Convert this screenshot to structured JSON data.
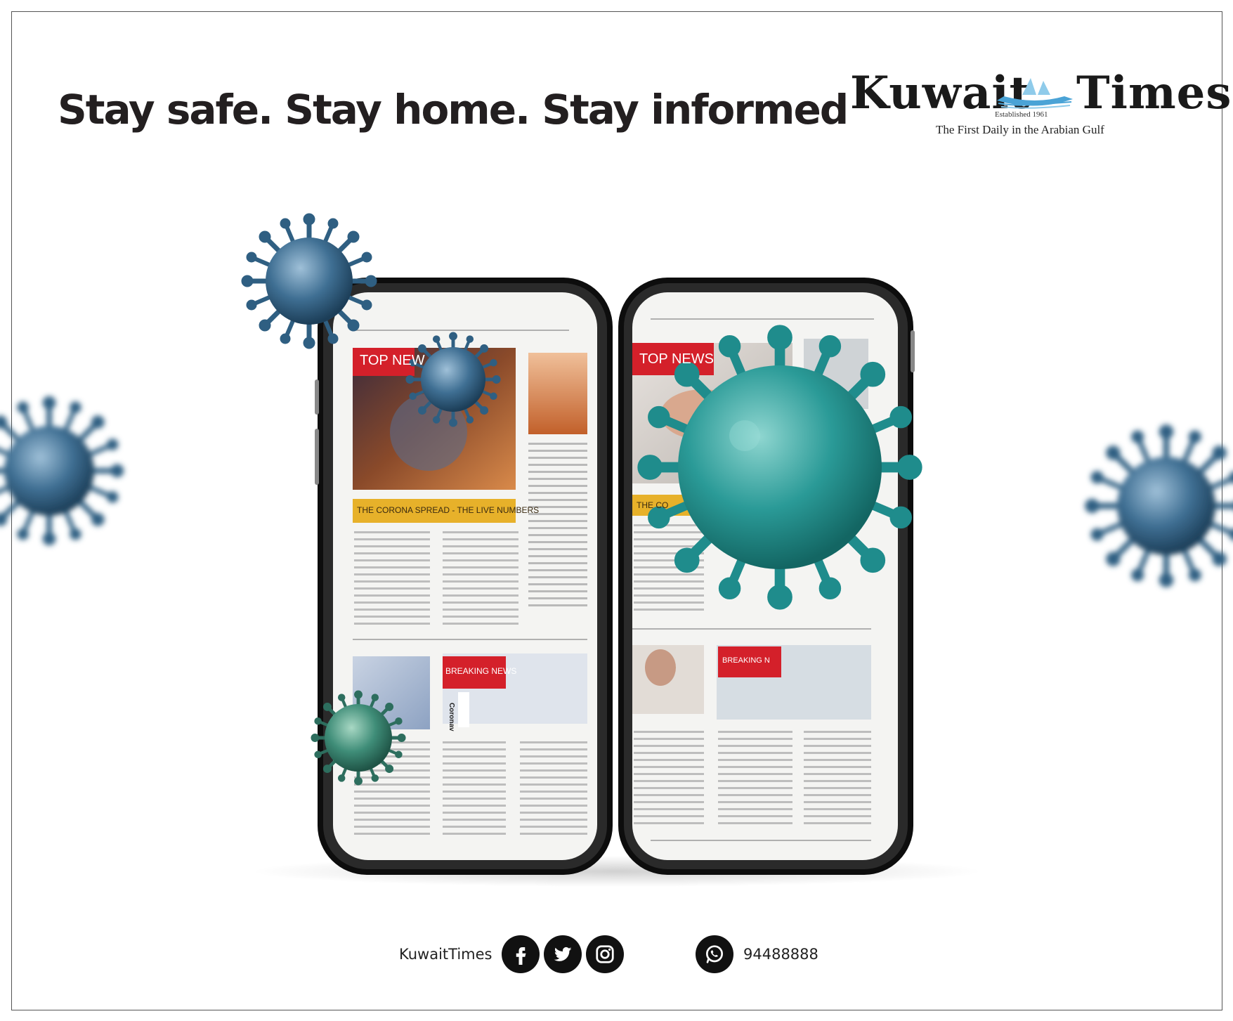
{
  "headline": "Stay safe. Stay home. Stay informed",
  "logo": {
    "word_left": "Kuwait",
    "word_right": "Times",
    "established": "Established 1961",
    "tagline": "The First Daily in the Arabian Gulf"
  },
  "left_phone": {
    "top_news_label": "TOP NEW",
    "banner": "THE CORONA SPREAD - THE LIVE NUMBERS",
    "breaking_label": "BREAKING NEWS",
    "side_caption": "Coronav"
  },
  "right_phone": {
    "top_news_label": "TOP NEWS",
    "banner": "THE CO",
    "breaking_label": "BREAKING N"
  },
  "footer": {
    "handle": "KuwaitTimes",
    "phone": "94488888"
  },
  "icons": [
    "facebook-icon",
    "twitter-icon",
    "instagram-icon",
    "whatsapp-icon",
    "virus-icon",
    "ship-icon"
  ],
  "colors": {
    "headline": "#231f20",
    "news_red": "#d4202a",
    "banner_yellow": "#e7b12a",
    "virus_blue": "#2f5f82",
    "virus_teal": "#1f8c8c",
    "phone_frame": "#1a1a1a"
  }
}
